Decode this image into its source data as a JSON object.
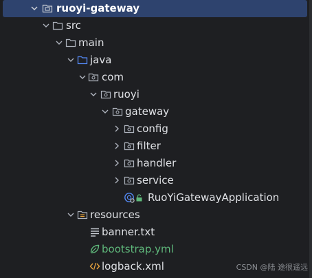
{
  "tree": {
    "items": [
      {
        "label": "ruoyi-gateway"
      },
      {
        "label": "src"
      },
      {
        "label": "main"
      },
      {
        "label": "java"
      },
      {
        "label": "com"
      },
      {
        "label": "ruoyi"
      },
      {
        "label": "gateway"
      },
      {
        "label": "config"
      },
      {
        "label": "filter"
      },
      {
        "label": "handler"
      },
      {
        "label": "service"
      },
      {
        "label": "RuoYiGatewayApplication"
      },
      {
        "label": "resources"
      },
      {
        "label": "banner.txt"
      },
      {
        "label": "bootstrap.yml"
      },
      {
        "label": "logback.xml"
      }
    ]
  },
  "watermark": "CSDN @陆 途很遥远",
  "colors": {
    "background": "#1e1f22",
    "selection": "#2e436e",
    "folder_icon": "#aeb3bd",
    "java_folder": "#548af7",
    "yml_text": "#5fb87b",
    "xml_icon": "#e8a33d"
  }
}
